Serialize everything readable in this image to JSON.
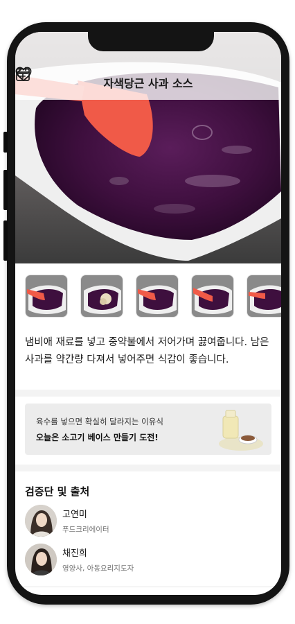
{
  "header": {
    "title": "자색당근 사과 소스",
    "back_icon": "arrow-left-icon",
    "favorite_icon": "heart-icon",
    "calendar_icon": "calendar-add-icon"
  },
  "hero": {
    "image": "purple-sauce-in-heart-dish-photo"
  },
  "thumbnails": [
    {
      "image": "sauce-with-red-spatula"
    },
    {
      "image": "sauce-with-minced-apple"
    },
    {
      "image": "sauce-with-red-spatula-2"
    },
    {
      "image": "sauce-with-red-spatula-3"
    },
    {
      "image": "sauce-with-red-spatula-4"
    }
  ],
  "step": {
    "description": "냄비애 재료를 넣고 중약불에서 저어가며 끓여줍니다. 남은 사과를 약간량 다져서 넣어주면 식감이 좋습니다."
  },
  "promo": {
    "subtitle": "육수를 넣으면 확실히 달라지는 이유식",
    "title": "오늘은 소고기 베이스 만들기 도전!"
  },
  "verification": {
    "title": "검증단 및 출처",
    "people": [
      {
        "name": "고연미",
        "role": "푸드크리에이터"
      },
      {
        "name": "채진희",
        "role": "영양사, 아동요리지도자"
      }
    ]
  },
  "colors": {
    "sauce_purple": "#3a0f3a",
    "spatula_red": "#f05a48",
    "frame": "#141414"
  }
}
